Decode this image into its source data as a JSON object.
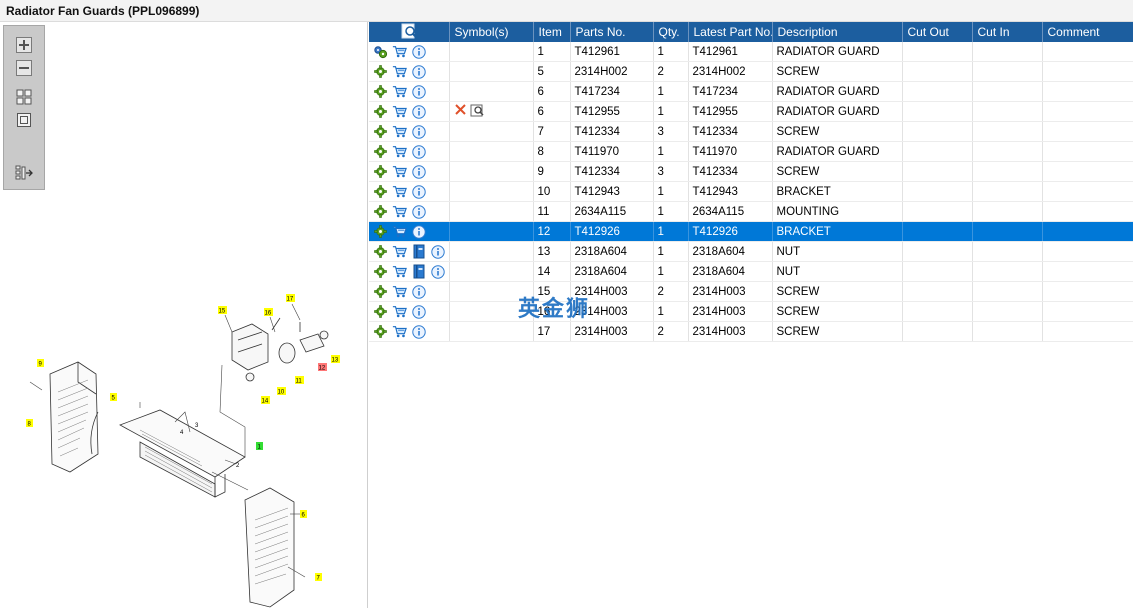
{
  "window": {
    "title": "Radiator Fan Guards (PPL096899)"
  },
  "toolbox": {
    "buttons": [
      "zoom-in-icon",
      "zoom-out-icon",
      "fit-all-icon",
      "actual-size-icon",
      "export-icon"
    ]
  },
  "diagram": {
    "callouts": [
      {
        "label": "1",
        "highlight": "green"
      },
      {
        "label": "2",
        "highlight": "none"
      },
      {
        "label": "3",
        "highlight": "none"
      },
      {
        "label": "4",
        "highlight": "none"
      },
      {
        "label": "5",
        "highlight": "yellow"
      },
      {
        "label": "6",
        "highlight": "yellow"
      },
      {
        "label": "7",
        "highlight": "yellow"
      },
      {
        "label": "8",
        "highlight": "yellow"
      },
      {
        "label": "9",
        "highlight": "yellow"
      },
      {
        "label": "10",
        "highlight": "yellow"
      },
      {
        "label": "11",
        "highlight": "yellow"
      },
      {
        "label": "12",
        "highlight": "red"
      },
      {
        "label": "13",
        "highlight": "yellow"
      },
      {
        "label": "14",
        "highlight": "yellow"
      },
      {
        "label": "15",
        "highlight": "yellow"
      },
      {
        "label": "16",
        "highlight": "yellow"
      },
      {
        "label": "17",
        "highlight": "yellow"
      }
    ],
    "colors": {
      "yellow": "#ffff00",
      "green": "#33dd33",
      "red": "#ff7777"
    }
  },
  "table": {
    "columns": [
      "",
      "Symbol(s)",
      "Item",
      "Parts No.",
      "Qty.",
      "Latest Part No.",
      "Description",
      "Cut Out",
      "Cut In",
      "Comment"
    ],
    "rows": [
      {
        "item": "1",
        "part": "T412961",
        "qty": "1",
        "latest": "T412961",
        "desc": "RADIATOR GUARD",
        "symbol": "",
        "first_icon": "gears-icon",
        "extra_icon": ""
      },
      {
        "item": "5",
        "part": "2314H002",
        "qty": "2",
        "latest": "2314H002",
        "desc": "SCREW",
        "symbol": "",
        "first_icon": "gear-icon",
        "extra_icon": ""
      },
      {
        "item": "6",
        "part": "T417234",
        "qty": "1",
        "latest": "T417234",
        "desc": "RADIATOR GUARD",
        "symbol": "",
        "first_icon": "gear-icon",
        "extra_icon": ""
      },
      {
        "item": "6",
        "part": "T412955",
        "qty": "1",
        "latest": "T412955",
        "desc": "RADIATOR GUARD",
        "symbol": "superseded",
        "first_icon": "gear-icon",
        "extra_icon": ""
      },
      {
        "item": "7",
        "part": "T412334",
        "qty": "3",
        "latest": "T412334",
        "desc": "SCREW",
        "symbol": "",
        "first_icon": "gear-icon",
        "extra_icon": ""
      },
      {
        "item": "8",
        "part": "T411970",
        "qty": "1",
        "latest": "T411970",
        "desc": "RADIATOR GUARD",
        "symbol": "",
        "first_icon": "gear-icon",
        "extra_icon": ""
      },
      {
        "item": "9",
        "part": "T412334",
        "qty": "3",
        "latest": "T412334",
        "desc": "SCREW",
        "symbol": "",
        "first_icon": "gear-icon",
        "extra_icon": ""
      },
      {
        "item": "10",
        "part": "T412943",
        "qty": "1",
        "latest": "T412943",
        "desc": "BRACKET",
        "symbol": "",
        "first_icon": "gear-icon",
        "extra_icon": ""
      },
      {
        "item": "11",
        "part": "2634A115",
        "qty": "1",
        "latest": "2634A115",
        "desc": "MOUNTING",
        "symbol": "",
        "first_icon": "gear-icon",
        "extra_icon": ""
      },
      {
        "item": "12",
        "part": "T412926",
        "qty": "1",
        "latest": "T412926",
        "desc": "BRACKET",
        "symbol": "",
        "first_icon": "gear-icon",
        "extra_icon": "",
        "selected": true
      },
      {
        "item": "13",
        "part": "2318A604",
        "qty": "1",
        "latest": "2318A604",
        "desc": "NUT",
        "symbol": "",
        "first_icon": "gear-icon",
        "extra_icon": "book-icon"
      },
      {
        "item": "14",
        "part": "2318A604",
        "qty": "1",
        "latest": "2318A604",
        "desc": "NUT",
        "symbol": "",
        "first_icon": "gear-icon",
        "extra_icon": "book-icon"
      },
      {
        "item": "15",
        "part": "2314H003",
        "qty": "2",
        "latest": "2314H003",
        "desc": "SCREW",
        "symbol": "",
        "first_icon": "gear-icon",
        "extra_icon": ""
      },
      {
        "item": "16",
        "part": "2314H003",
        "qty": "1",
        "latest": "2314H003",
        "desc": "SCREW",
        "symbol": "",
        "first_icon": "gear-icon",
        "extra_icon": ""
      },
      {
        "item": "17",
        "part": "2314H003",
        "qty": "2",
        "latest": "2314H003",
        "desc": "SCREW",
        "symbol": "",
        "first_icon": "gear-icon",
        "extra_icon": ""
      }
    ]
  },
  "watermark": "英金狮",
  "colors": {
    "header": "#1c5e9f",
    "selected_row": "#0078d7",
    "gear": "#5aa020",
    "info": "#2f7cd1"
  }
}
